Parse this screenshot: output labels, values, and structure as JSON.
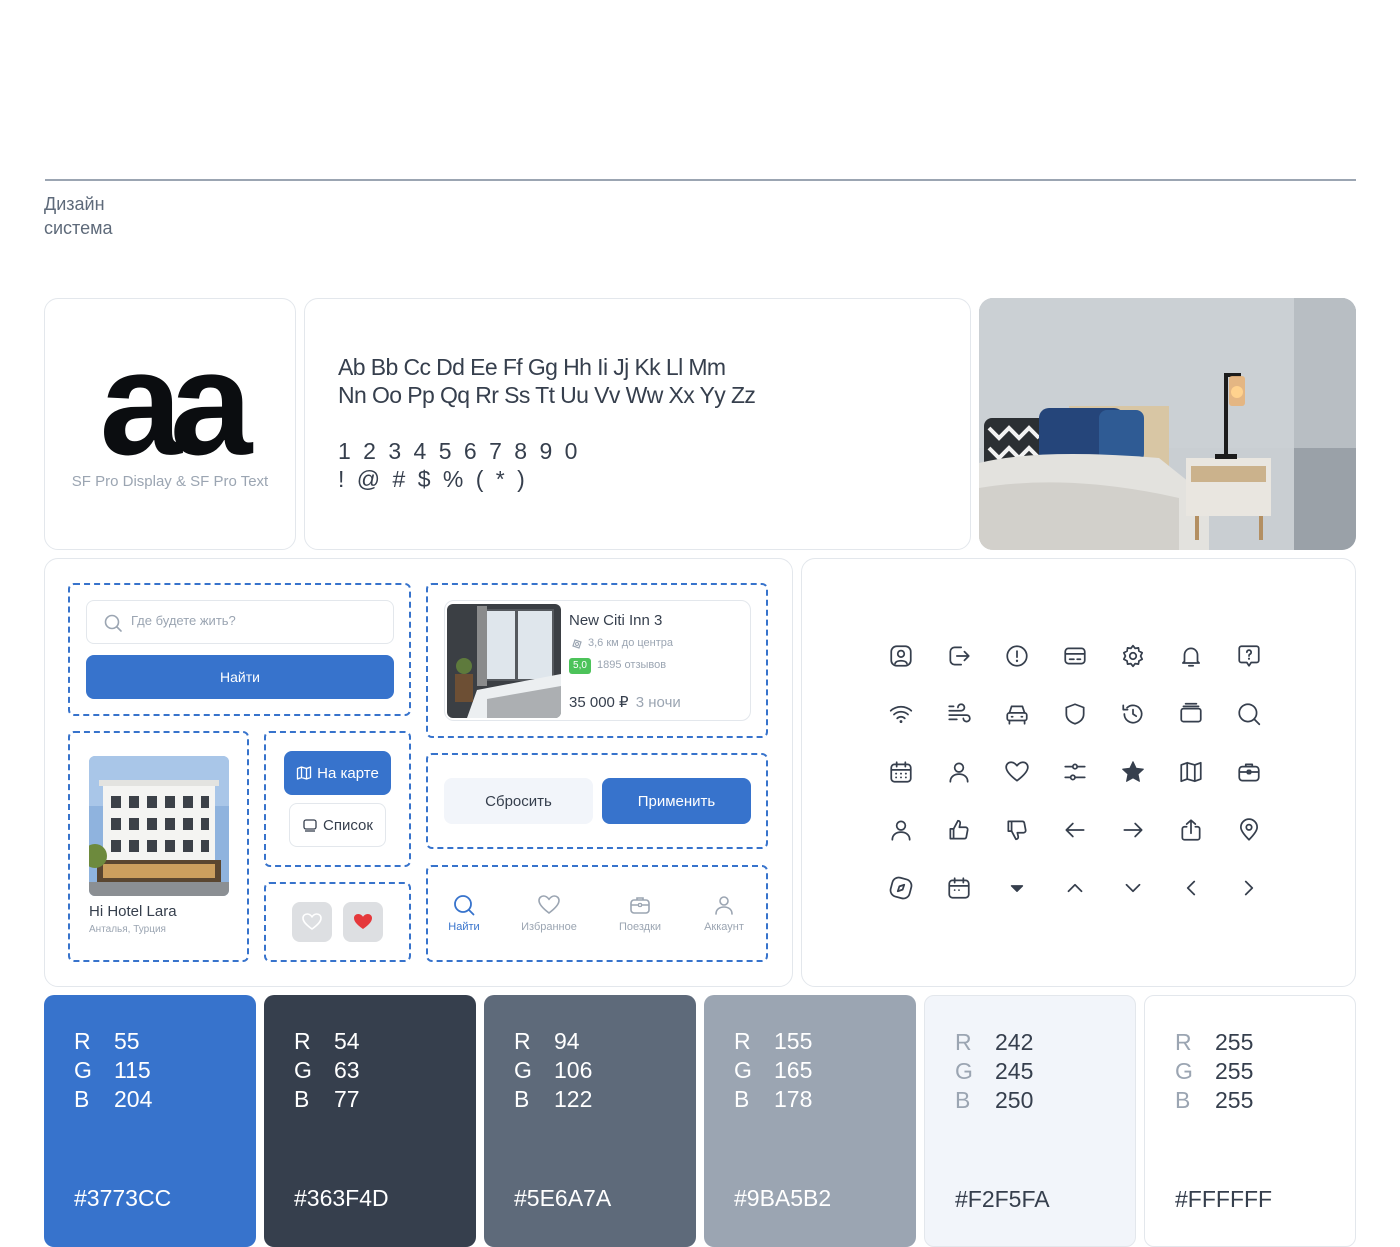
{
  "header": {
    "title": "Дизайн\nсистема"
  },
  "typeface": {
    "glyphs": "aa",
    "caption": "SF Pro Display & SF Pro Text",
    "alphabet_line1": "Ab Bb Cc Dd Ee Ff Gg Hh Ii Jj Kk Ll Mm",
    "alphabet_line2": "Nn Oo Pp Qq Rr Ss Tt Uu Vv Ww Xx Yy Zz",
    "digits": "1 2 3 4 5 6 7 8 9 0",
    "symbols": "! @ # $ % ( * )"
  },
  "search": {
    "placeholder": "Где будете жить?",
    "button": "Найти"
  },
  "hotel_card": {
    "name": "New Citi Inn 3",
    "distance": "3,6 км до центра",
    "rating": "5,0",
    "reviews": "1895 отзывов",
    "price": "35 000 ₽",
    "nights": "3 ночи"
  },
  "hotel_tile": {
    "name": "Hi Hotel Lara",
    "location": "Анталья, Турция"
  },
  "view_toggle": {
    "map": "На карте",
    "list": "Список"
  },
  "filters": {
    "reset": "Сбросить",
    "apply": "Применить"
  },
  "tabbar": [
    {
      "label": "Найти",
      "icon": "search-icon",
      "active": true
    },
    {
      "label": "Избранное",
      "icon": "heart-icon",
      "active": false
    },
    {
      "label": "Поездки",
      "icon": "briefcase-icon",
      "active": false
    },
    {
      "label": "Аккаунт",
      "icon": "user-icon",
      "active": false
    }
  ],
  "icons": [
    [
      "user-square-icon",
      "logout-icon",
      "alert-circle-icon",
      "credit-card-icon",
      "settings-icon",
      "bell-icon",
      "help-chat-icon"
    ],
    [
      "wifi-icon",
      "wind-icon",
      "car-icon",
      "shield-icon",
      "history-icon",
      "gallery-icon",
      "search-icon"
    ],
    [
      "calendar-grid-icon",
      "user-icon",
      "heart-icon",
      "sliders-icon",
      "star-filled-icon",
      "map-icon",
      "briefcase-icon"
    ],
    [
      "user-outline-icon",
      "thumbs-up-icon",
      "thumbs-down-icon",
      "arrow-left-icon",
      "arrow-right-icon",
      "share-icon",
      "location-pin-icon"
    ],
    [
      "compass-icon",
      "calendar-icon",
      "caret-down-filled-icon",
      "chevron-up-icon",
      "chevron-down-icon",
      "chevron-left-icon",
      "chevron-right-icon"
    ]
  ],
  "palette": [
    {
      "r": "55",
      "g": "115",
      "b": "204",
      "hex": "#3773CC",
      "bg": "#3773CC",
      "fg": "#FFFFFF"
    },
    {
      "r": "54",
      "g": "63",
      "b": "77",
      "hex": "#363F4D",
      "bg": "#363F4D",
      "fg": "#FFFFFF"
    },
    {
      "r": "94",
      "g": "106",
      "b": "122",
      "hex": "#5E6A7A",
      "bg": "#5E6A7A",
      "fg": "#FFFFFF"
    },
    {
      "r": "155",
      "g": "165",
      "b": "178",
      "hex": "#9BA5B2",
      "bg": "#9BA5B2",
      "fg": "#FFFFFF"
    },
    {
      "r": "242",
      "g": "245",
      "b": "250",
      "hex": "#F2F5FA",
      "bg": "#F2F5FA",
      "fg": "#363F4D"
    },
    {
      "r": "255",
      "g": "255",
      "b": "255",
      "hex": "#FFFFFF",
      "bg": "#FFFFFF",
      "fg": "#363F4D"
    }
  ],
  "rgb_labels": {
    "r": "R",
    "g": "G",
    "b": "B"
  },
  "colors": {
    "accent": "#3773CC",
    "rating": "#4CC35A",
    "favorite": "#E5383B"
  }
}
